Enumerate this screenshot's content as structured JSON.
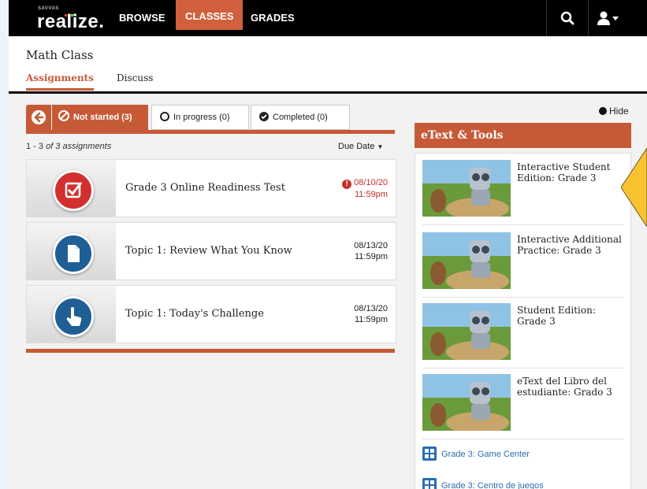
{
  "nav": {
    "logo_small": "SAVVAS",
    "logo": "realize.",
    "items": [
      {
        "label": "BROWSE"
      },
      {
        "label": "CLASSES"
      },
      {
        "label": "GRADES"
      }
    ]
  },
  "class": {
    "title": "Math Class",
    "tabs": [
      {
        "label": "Assignments"
      },
      {
        "label": "Discuss"
      }
    ]
  },
  "filters": {
    "not_started": "Not started (3)",
    "in_progress": "In progress (0)",
    "completed": "Completed (0)"
  },
  "list": {
    "count_prefix": "1 - 3",
    "count_suffix": "of 3 assignments",
    "sort_label": "Due Date"
  },
  "assignments": [
    {
      "title": "Grade 3 Online Readiness Test",
      "date": "08/10/20",
      "time": "11:59pm",
      "icon": "checkbox-icon",
      "color": "#d32f2f",
      "overdue": true
    },
    {
      "title": "Topic 1: Review What You Know",
      "date": "08/13/20",
      "time": "11:59pm",
      "icon": "document-icon",
      "color": "#1f5f96",
      "overdue": false
    },
    {
      "title": "Topic 1: Today's Challenge",
      "date": "08/13/20",
      "time": "11:59pm",
      "icon": "hand-pointer-icon",
      "color": "#1f5f96",
      "overdue": false
    }
  ],
  "panel": {
    "hide_label": "Hide",
    "header": "eText & Tools",
    "tools": [
      {
        "title": "Interactive Student Edition: Grade 3"
      },
      {
        "title": "Interactive Additional Practice: Grade 3"
      },
      {
        "title": "Student Edition: Grade 3"
      },
      {
        "title": "eText del Libro del estudiante: Grado 3"
      }
    ],
    "links": [
      {
        "label": "Grade 3: Game Center"
      },
      {
        "label": "Grade 3: Centro de juegos"
      }
    ]
  },
  "colors": {
    "accent": "#c65a37",
    "link": "#2a6db0",
    "overdue": "#c4302b",
    "callout": "#f7c331"
  }
}
